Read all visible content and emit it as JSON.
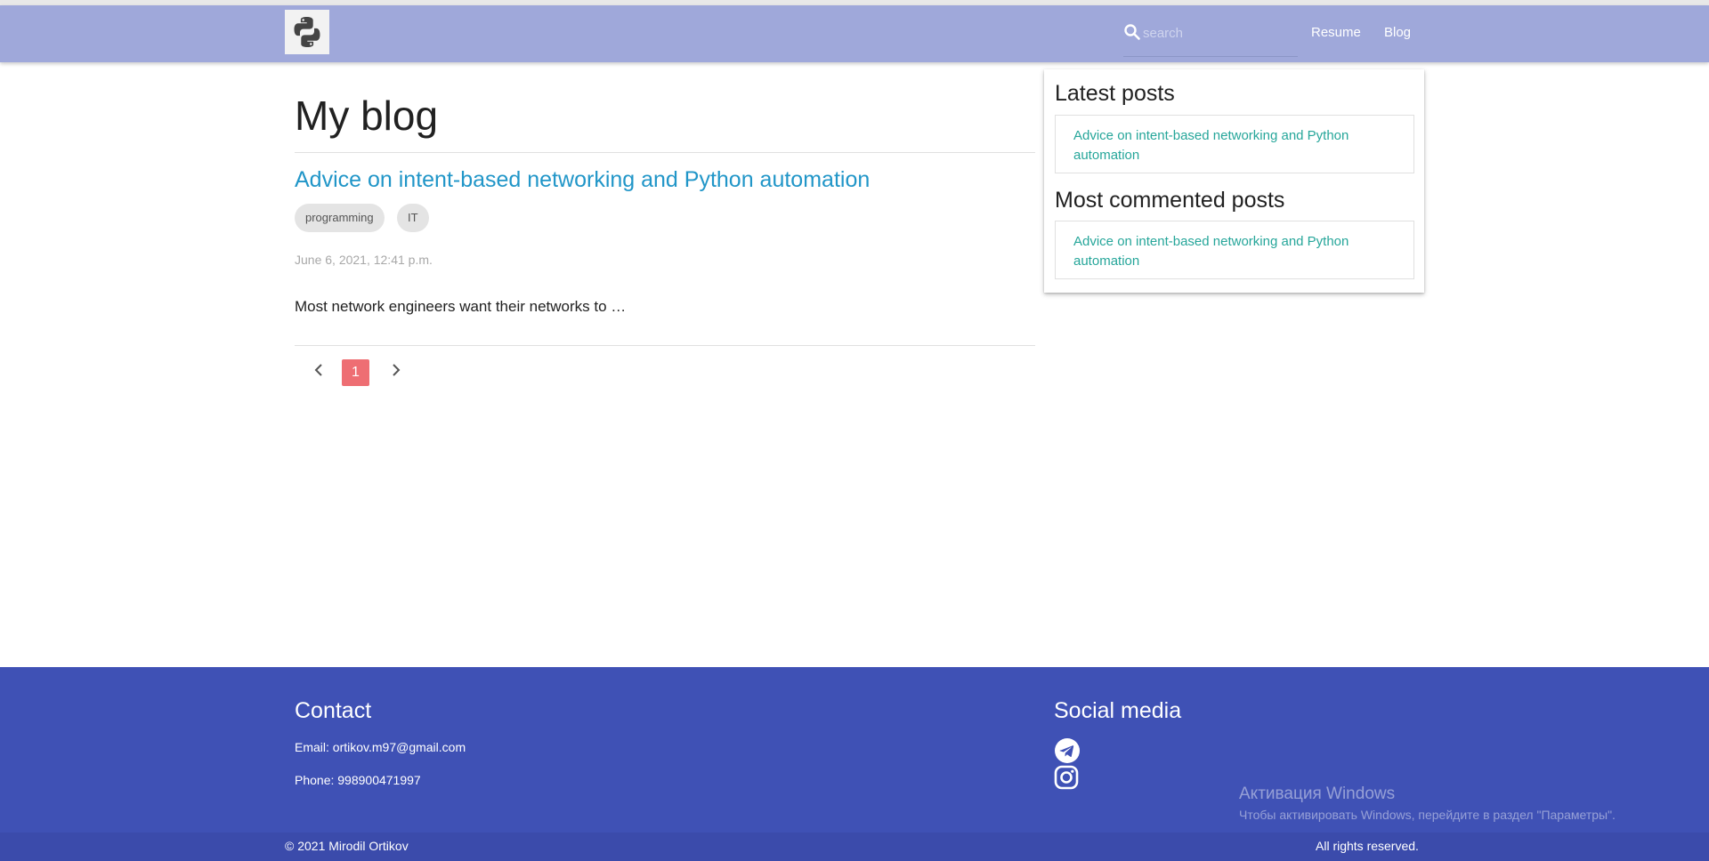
{
  "navbar": {
    "search_placeholder": "search",
    "links": [
      "Resume",
      "Blog"
    ]
  },
  "main": {
    "title": "My blog",
    "posts": [
      {
        "title": "Advice on intent-based networking and Python automation",
        "tags": [
          "programming",
          "IT"
        ],
        "date": "June 6, 2021, 12:41 p.m.",
        "excerpt": "Most network engineers want their networks to …"
      }
    ],
    "pagination": {
      "current_page": "1"
    }
  },
  "sidebar": {
    "latest_heading": "Latest posts",
    "latest_posts": [
      "Advice on intent-based networking and Python automation"
    ],
    "commented_heading": "Most commented posts",
    "commented_posts": [
      "Advice on intent-based networking and Python automation"
    ]
  },
  "footer": {
    "contact_heading": "Contact",
    "email": "Email: ortikov.m97@gmail.com",
    "phone": "Phone: 998900471997",
    "social_heading": "Social media",
    "social_icons": [
      "telegram-icon",
      "instagram-icon"
    ],
    "copyright": "© 2021 Mirodil Ortikov",
    "rights": "All rights reserved."
  },
  "os_watermark": {
    "title": "Активация Windows",
    "subtitle": "Чтобы активировать Windows, перейдите в раздел \"Параметры\"."
  },
  "colors": {
    "navbar": "#9fa8da",
    "footer": "#3f51b5",
    "post_link": "#2196c8",
    "sidebar_link": "#26a69a",
    "active_page": "#ee6e73"
  }
}
